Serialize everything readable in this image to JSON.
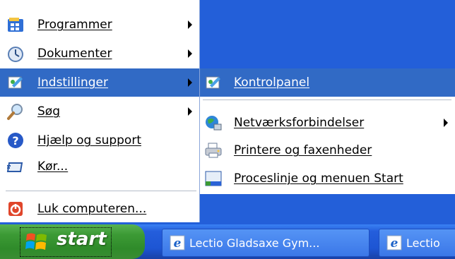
{
  "start_menu": {
    "items": [
      {
        "label": "Programmer",
        "has_submenu": true,
        "icon": "programs-icon"
      },
      {
        "label": "Dokumenter",
        "has_submenu": true,
        "icon": "documents-icon"
      },
      {
        "label": "Indstillinger",
        "has_submenu": true,
        "icon": "settings-icon",
        "highlighted": true
      },
      {
        "label": "Søg",
        "has_submenu": true,
        "icon": "search-icon"
      },
      {
        "label": "Hjælp og support",
        "has_submenu": false,
        "icon": "help-icon"
      },
      {
        "label": "Kør...",
        "has_submenu": false,
        "icon": "run-icon"
      },
      {
        "label": "Luk computeren...",
        "has_submenu": false,
        "icon": "shutdown-icon"
      }
    ]
  },
  "settings_submenu": {
    "items": [
      {
        "label": "Kontrolpanel",
        "icon": "control-panel-icon",
        "highlighted": true
      },
      {
        "label": "Netværksforbindelser",
        "icon": "network-icon",
        "has_submenu": true
      },
      {
        "label": "Printere og faxenheder",
        "icon": "printer-icon"
      },
      {
        "label": "Proceslinje og menuen Start",
        "icon": "taskbar-icon"
      }
    ]
  },
  "taskbar": {
    "start_label": "start",
    "tasks": [
      {
        "label": "Lectio Gladsaxe Gym...",
        "icon": "ie-icon"
      },
      {
        "label": "Lectio",
        "icon": "ie-icon"
      }
    ]
  },
  "colors": {
    "highlight": "#316ac5",
    "desktop_blue": "#235fd9",
    "start_green": "#3c9a35"
  }
}
